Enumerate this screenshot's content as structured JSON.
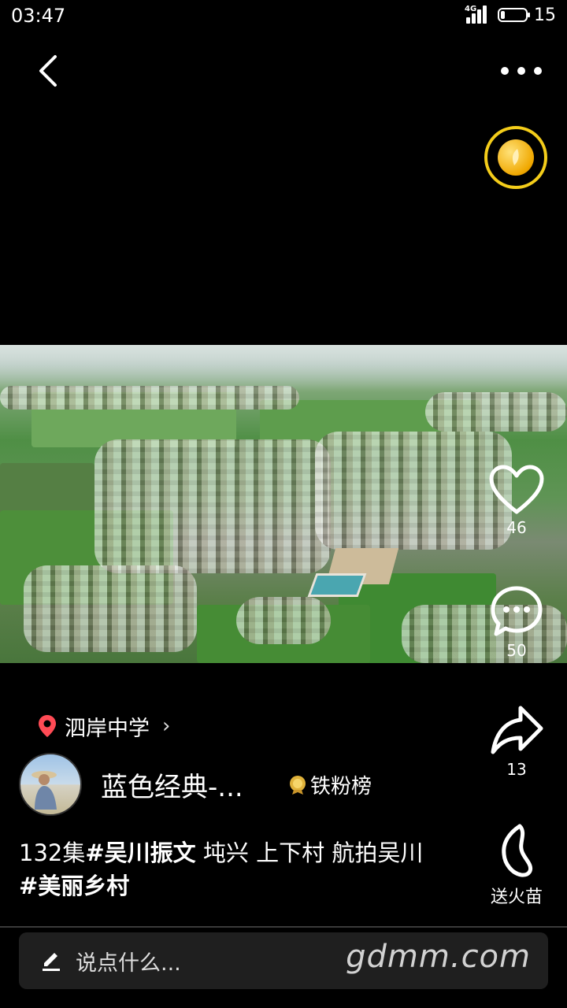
{
  "status_bar": {
    "time": "03:47",
    "network": "4G",
    "battery": "15",
    "battery_fraction": 0.15
  },
  "location": {
    "name": "泗岸中学"
  },
  "author": {
    "name": "蓝色经典-...",
    "badge_label": "铁粉榜"
  },
  "caption": {
    "episode": "132集",
    "tag1": "#吴川振文",
    "text1": " 坉兴 上下村 航拍吴川 ",
    "tag2": "#美丽乡村"
  },
  "actions": {
    "like_count": "46",
    "comment_count": "50",
    "share_count": "13",
    "fire_label": "送火苗"
  },
  "comment_bar": {
    "placeholder": "说点什么..."
  },
  "watermark": "gdmm.com",
  "icons": {
    "back": "chevron-left-icon",
    "more": "more-dots-icon",
    "coin": "gold-coin-icon",
    "like": "heart-icon",
    "comment": "comment-bubble-icon",
    "share": "share-arrow-icon",
    "fire": "flame-icon",
    "location": "location-pin-icon",
    "edit": "pencil-icon"
  },
  "colors": {
    "coin_ring": "#f4cd1a",
    "pin": "#ff4b55",
    "background": "#000000"
  }
}
